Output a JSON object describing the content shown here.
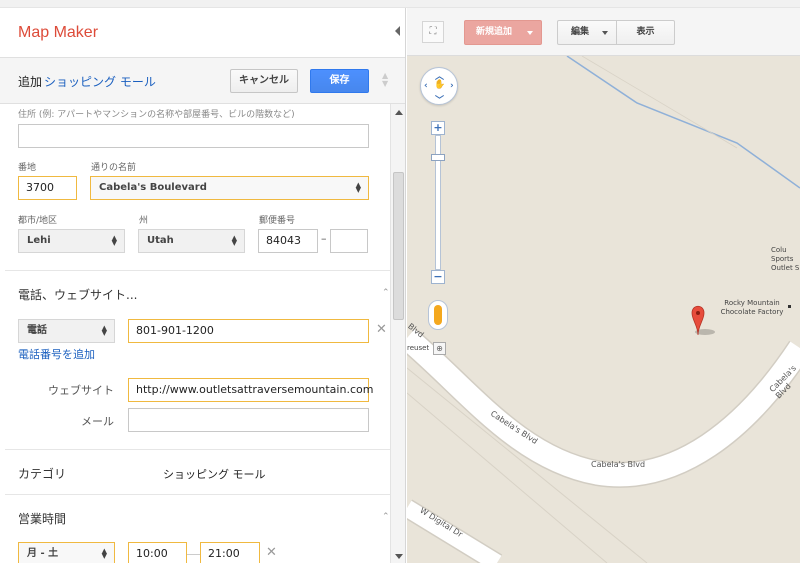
{
  "app": {
    "brand": "Map Maker"
  },
  "header": {
    "action": "追加",
    "place_type": "ショッピング モール",
    "cancel_label": "キャンセル",
    "save_label": "保存"
  },
  "address": {
    "hint": "住所 (例: アパートやマンションの名称や部屋番号、ビルの階数など)",
    "extra_value": "",
    "number_label": "番地",
    "number_value": "3700",
    "street_label": "通りの名前",
    "street_value": "Cabela's Boulevard",
    "city_label": "都市/地区",
    "city_value": "Lehi",
    "state_label": "州",
    "state_value": "Utah",
    "zip_label": "郵便番号",
    "zip_value": "84043",
    "zip_separator": "–",
    "zip_ext_value": ""
  },
  "contact": {
    "section_title": "電話、ウェブサイト...",
    "phone_type": "電話",
    "phone_value": "801-901-1200",
    "add_phone_link": "電話番号を追加",
    "website_label": "ウェブサイト",
    "website_value": "http://www.outletsattraversemountain.com",
    "email_label": "メール",
    "email_value": ""
  },
  "category": {
    "label": "カテゴリ",
    "value": "ショッピング モール"
  },
  "hours": {
    "section_title": "営業時間",
    "days": "月 - 土",
    "open": "10:00",
    "close": "21:00"
  },
  "map_toolbar": {
    "new_label": "新規追加",
    "edit_label": "編集",
    "view_label": "表示"
  },
  "map": {
    "poi_name": "Rocky Mountain Chocolate Factory",
    "poi_partial": "Colu Sports Outlet S",
    "road_labels": [
      "Cabela's Blvd",
      "Cabela's Blvd",
      "Cabela's Blvd",
      "W Digital Dr",
      "Blvd"
    ],
    "partial_label": "reuset",
    "colors": {
      "background": "#e9e4d9",
      "road": "#ffffff",
      "road_edge": "#d2cdc3",
      "water": "#8fb0d8",
      "marker": "#e74c3c"
    }
  },
  "icons": [
    "collapse-left-icon",
    "fullscreen-icon",
    "pan-control-icon",
    "zoom-in-icon",
    "zoom-out-icon",
    "pegman-icon",
    "magnify-icon",
    "map-marker-icon",
    "clear-icon",
    "chevron-up-icon",
    "select-arrows-icon"
  ],
  "colors": {
    "brand": "#dd4b39",
    "link": "#1a5fbf",
    "save": "#4d90fe",
    "highlight_border": "#f0b940",
    "new_button": "#eba6a0"
  }
}
